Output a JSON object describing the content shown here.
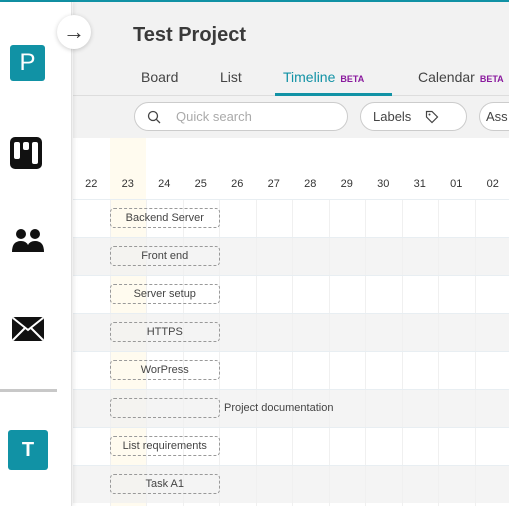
{
  "colors": {
    "accent": "#1192a5",
    "beta": "#8a1a9e",
    "today_highlight": "#fffbef"
  },
  "sidebar": {
    "items": [
      {
        "label": "P",
        "icon": "project-avatar"
      },
      {
        "icon": "board-icon"
      },
      {
        "icon": "people-icon"
      },
      {
        "icon": "mail-icon"
      },
      {
        "label": "T",
        "icon": "user-avatar"
      }
    ],
    "toggle_icon": "→"
  },
  "header": {
    "title": "Test Project",
    "tabs": [
      {
        "label": "Board",
        "active": false
      },
      {
        "label": "List",
        "active": false
      },
      {
        "label": "Timeline",
        "badge": "BETA",
        "active": true
      },
      {
        "label": "Calendar",
        "badge": "BETA",
        "active": false
      }
    ]
  },
  "toolbar": {
    "search_placeholder": "Quick search",
    "labels_button": "Labels",
    "assignees_button": "Ass"
  },
  "timeline": {
    "dates": [
      "22",
      "23",
      "24",
      "25",
      "26",
      "27",
      "28",
      "29",
      "30",
      "31",
      "01",
      "02"
    ],
    "highlighted_date": "23",
    "tasks": [
      {
        "name": "Backend Server",
        "start": "23",
        "end": "25"
      },
      {
        "name": "Front end",
        "start": "23",
        "end": "25"
      },
      {
        "name": "Server setup",
        "start": "23",
        "end": "25"
      },
      {
        "name": "HTTPS",
        "start": "23",
        "end": "25"
      },
      {
        "name": "WorPress",
        "start": "23",
        "end": "25"
      },
      {
        "name": "Project documentation",
        "start": "23",
        "end": "25",
        "label_outside": true
      },
      {
        "name": "List requirements",
        "start": "23",
        "end": "25"
      },
      {
        "name": "Task A1",
        "start": "23",
        "end": "25"
      }
    ]
  }
}
